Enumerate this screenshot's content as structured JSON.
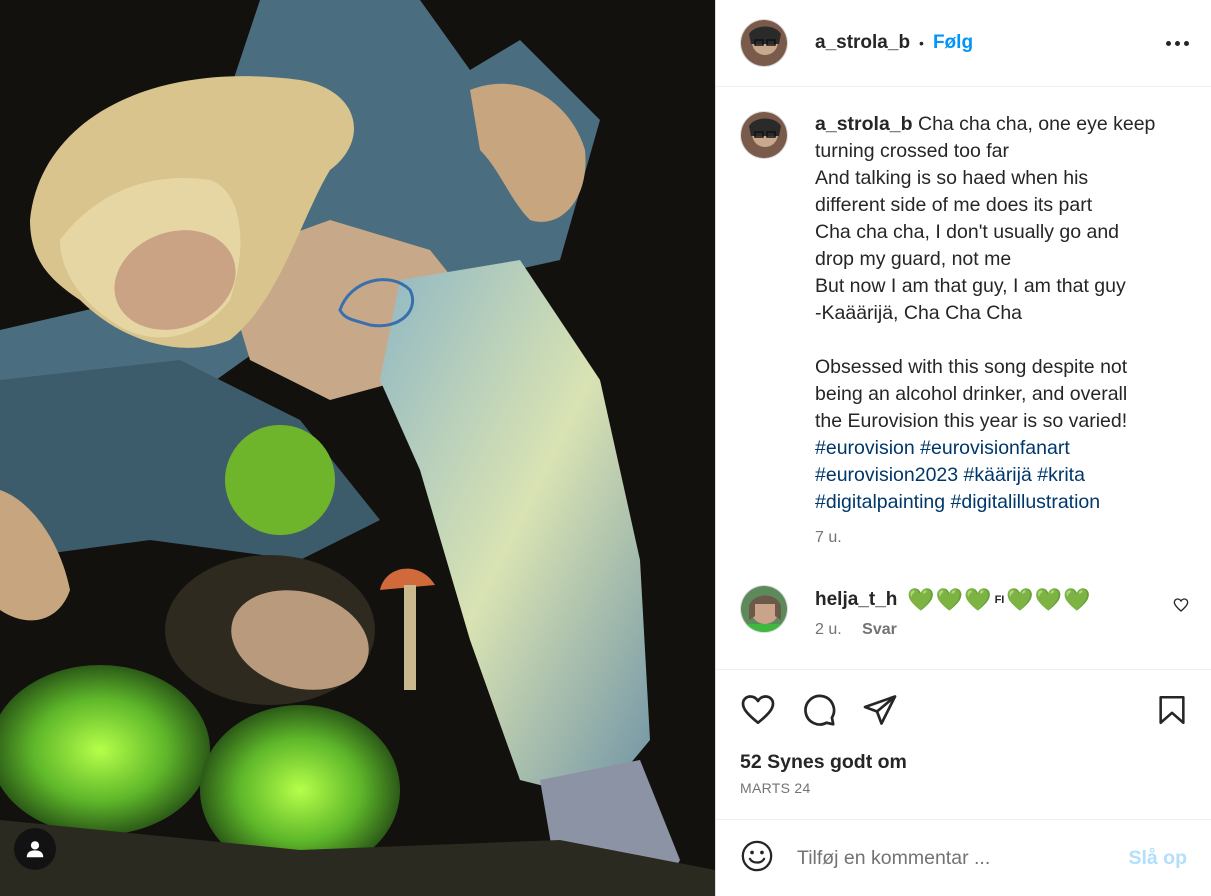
{
  "header": {
    "username": "a_strola_b",
    "separator": "•",
    "follow_label": "Følg"
  },
  "caption": {
    "username": "a_strola_b",
    "lines": [
      "Cha cha cha, one eye keep",
      "turning crossed too far",
      "And talking is so haed when his",
      "different side of me does its part",
      "Cha cha cha, I don't usually go and",
      "drop my guard, not me",
      "But now I am that guy, I am that guy",
      "-Kaäärijä, Cha Cha Cha"
    ],
    "paragraph2": [
      "Obsessed with this song despite not",
      "being an alcohol drinker, and overall",
      "the Eurovision this year is so varied!"
    ],
    "hashtags": [
      [
        "#eurovision",
        "#eurovisionfanart"
      ],
      [
        "#eurovision2023",
        "#käärijä",
        "#krita"
      ],
      [
        "#digitalpainting",
        "#digitalillustration"
      ]
    ],
    "age": "7 u."
  },
  "comment": {
    "username": "helja_t_h",
    "hearts_before": "💚💚💚",
    "flag": "FI",
    "hearts_after": "💚💚💚",
    "age": "2 u.",
    "reply_label": "Svar"
  },
  "stats": {
    "likes": "52 Synes godt om",
    "date": "MARTS 24"
  },
  "composer": {
    "placeholder": "Tilføj en kommentar ...",
    "post_label": "Slå op"
  },
  "icons": {
    "like": "heart-icon",
    "comment": "comment-icon",
    "share": "share-icon",
    "save": "bookmark-icon",
    "emoji": "emoji-icon",
    "tags": "user-tag-icon"
  },
  "colors": {
    "link": "#0095f6",
    "hashtag": "#00376b",
    "post_disabled": "#b2dffc",
    "muted": "#737373"
  }
}
